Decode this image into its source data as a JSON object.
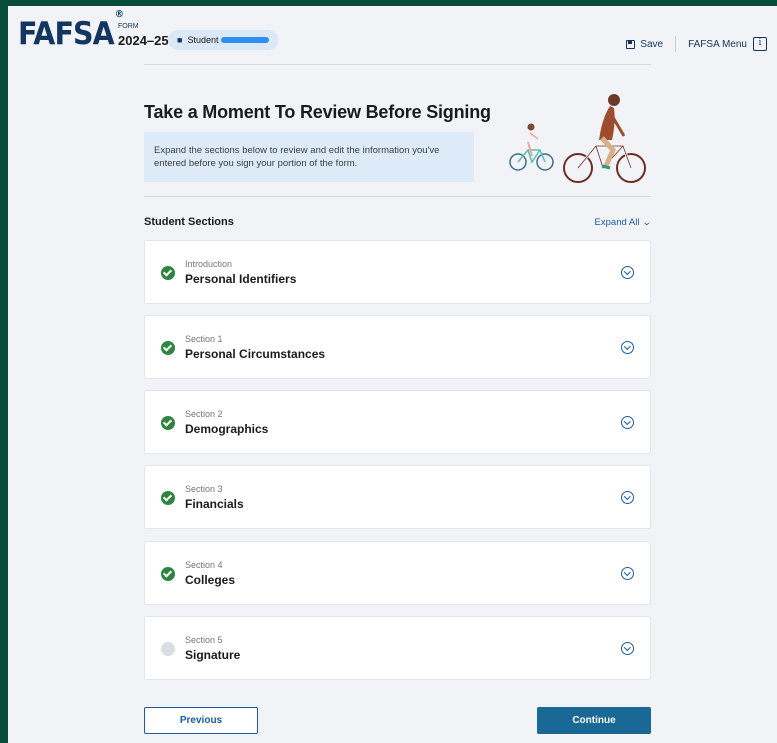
{
  "header": {
    "logo": "FAFSA",
    "logo_mark": "®",
    "form_label": "FORM",
    "form_year": "2024–25",
    "role_label": "Student",
    "save_label": "Save",
    "menu_label": "FAFSA Menu",
    "info_glyph": "i"
  },
  "page": {
    "title": "Take a Moment To Review Before Signing",
    "callout": "Expand the sections below to review and edit the information you've entered before you sign your portion of the form."
  },
  "sections_header": {
    "title": "Student Sections",
    "expand_all": "Expand All"
  },
  "sections": [
    {
      "kicker": "Introduction",
      "name": "Personal Identifiers",
      "status": "complete"
    },
    {
      "kicker": "Section 1",
      "name": "Personal Circumstances",
      "status": "complete"
    },
    {
      "kicker": "Section 2",
      "name": "Demographics",
      "status": "complete"
    },
    {
      "kicker": "Section 3",
      "name": "Financials",
      "status": "complete"
    },
    {
      "kicker": "Section 4",
      "name": "Colleges",
      "status": "complete"
    },
    {
      "kicker": "Section 5",
      "name": "Signature",
      "status": "incomplete"
    }
  ],
  "buttons": {
    "previous": "Previous",
    "continue": "Continue"
  },
  "colors": {
    "frame_bg": "#064d3a",
    "brand_navy": "#12365f",
    "link_blue": "#1a5c9e",
    "complete_green": "#2e8540",
    "primary_button": "#1a6896"
  }
}
